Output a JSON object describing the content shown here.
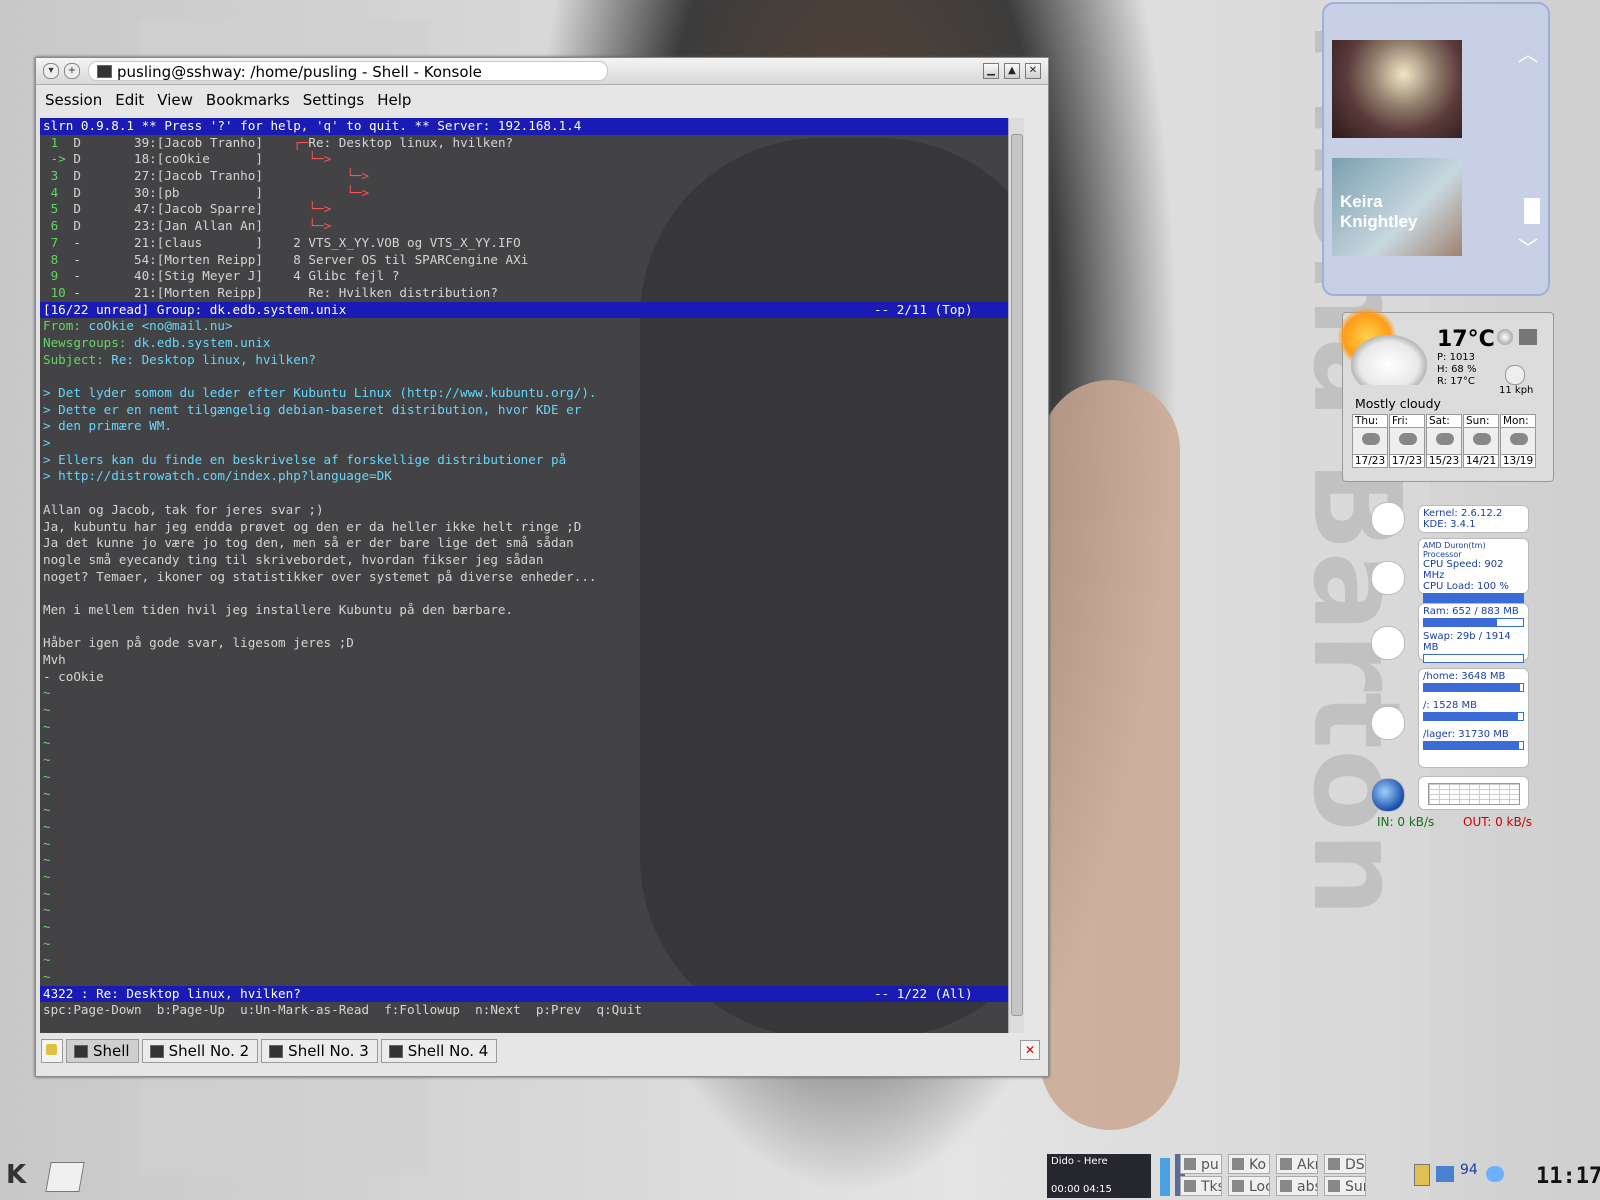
{
  "window": {
    "title": "pusling@sshway: /home/pusling - Shell - Konsole",
    "menu": [
      "Session",
      "Edit",
      "View",
      "Bookmarks",
      "Settings",
      "Help"
    ]
  },
  "terminal": {
    "header": "slrn 0.9.8.1 ** Press '?' for help, 'q' to quit. ** Server: 192.168.1.4",
    "threads": [
      {
        "num": "1",
        "flag": "D",
        "score": "39",
        "author": "[Jacob Tranho]",
        "tree": "┌─",
        "subject": "Re: Desktop linux, hvilken?"
      },
      {
        "num": "->",
        "flag": "D",
        "score": "18",
        "author": "[coOkie      ]",
        "tree": "  └─>",
        "subject": ""
      },
      {
        "num": "3",
        "flag": "D",
        "score": "27",
        "author": "[Jacob Tranho]",
        "tree": "       └─>",
        "subject": ""
      },
      {
        "num": "4",
        "flag": "D",
        "score": "30",
        "author": "[pb          ]",
        "tree": "       └─>",
        "subject": ""
      },
      {
        "num": "5",
        "flag": "D",
        "score": "47",
        "author": "[Jacob Sparre]",
        "tree": "  └─>",
        "subject": ""
      },
      {
        "num": "6",
        "flag": "D",
        "score": "23",
        "author": "[Jan Allan An]",
        "tree": "  └─>",
        "subject": ""
      },
      {
        "num": "7",
        "flag": "-",
        "score": "21",
        "author": "[claus       ]",
        "tree": "2 ",
        "subject": "VTS_X_YY.VOB og VTS_X_YY.IFO"
      },
      {
        "num": "8",
        "flag": "-",
        "score": "54",
        "author": "[Morten Reipp]",
        "tree": "8 ",
        "subject": "Server OS til SPARCengine AXi"
      },
      {
        "num": "9",
        "flag": "-",
        "score": "40",
        "author": "[Stig Meyer J]",
        "tree": "4 ",
        "subject": "Glibc fejl ?"
      },
      {
        "num": "10",
        "flag": "-",
        "score": "21",
        "author": "[Morten Reipp]",
        "tree": "  ",
        "subject": "Re: Hvilken distribution?"
      }
    ],
    "group_status_left": "[16/22 unread] Group: dk.edb.system.unix",
    "group_status_right": "-- 2/11 (Top)",
    "headers": {
      "from_label": "From:",
      "from": "coOkie <no@mail.nu>",
      "newsgroups_label": "Newsgroups:",
      "newsgroups": "dk.edb.system.unix",
      "subject_label": "Subject:",
      "subject": "Re: Desktop linux, hvilken?"
    },
    "quoted": [
      "> Det lyder somom du leder efter Kubuntu Linux (http://www.kubuntu.org/).",
      "> Dette er en nemt tilgængelig debian-baseret distribution, hvor KDE er",
      "> den primære WM.",
      ">",
      "> Ellers kan du finde en beskrivelse af forskellige distributioner på",
      "> http://distrowatch.com/index.php?language=DK"
    ],
    "body": [
      "",
      "Allan og Jacob, tak for jeres svar ;)",
      "Ja, kubuntu har jeg endda prøvet og den er da heller ikke helt ringe ;D",
      "Ja det kunne jo være jo tog den, men så er der bare lige det små sådan",
      "nogle små eyecandy ting til skrivebordet, hvordan fikser jeg sådan",
      "noget? Temaer, ikoner og statistikker over systemet på diverse enheder...",
      "",
      "Men i mellem tiden hvil jeg installere Kubuntu på den bærbare.",
      "",
      "Håber igen på gode svar, ligesom jeres ;D",
      "Mvh",
      "- coOkie"
    ],
    "tilde_count": 18,
    "article_status_left": "4322 : Re: Desktop linux, hvilken?",
    "article_status_right": "-- 1/22 (All)",
    "help_line": "spc:Page-Down  b:Page-Up  u:Un-Mark-as-Read  f:Followup  n:Next  p:Prev  q:Quit"
  },
  "tabs": [
    "Shell",
    "Shell No. 2",
    "Shell No. 3",
    "Shell No. 4"
  ],
  "image_widget": {
    "thumb2_caption": "Keira Knightley"
  },
  "weather": {
    "temp": "17°C",
    "pressure": "P: 1013",
    "humidity": "H: 68 %",
    "realfeel": "R: 17°C",
    "wind": "11 kph",
    "description": "Mostly cloudy",
    "forecast": [
      {
        "day": "Thu:",
        "temps": "17/23"
      },
      {
        "day": "Fri:",
        "temps": "17/23"
      },
      {
        "day": "Sat:",
        "temps": "15/23"
      },
      {
        "day": "Sun:",
        "temps": "14/21"
      },
      {
        "day": "Mon:",
        "temps": "13/19"
      }
    ]
  },
  "sysmon": {
    "kernel": "Kernel:  2.6.12.2",
    "kde": "KDE: 3.4.1",
    "cpu_name": "AMD Duron(tm) Processor",
    "cpu_speed": "CPU Speed:   902 MHz",
    "cpu_load": "CPU Load:   100 %",
    "cpu_load_frac": 1.0,
    "ram": "Ram: 652 / 883 MB",
    "ram_frac": 0.74,
    "swap": "Swap: 29b / 1914 MB",
    "swap_frac": 0.0,
    "home": "/home: 3648 MB",
    "home_frac": 0.97,
    "root": "/: 1528 MB",
    "root_frac": 0.95,
    "lager": "/lager: 31730 MB",
    "lager_frac": 0.96,
    "net_in": "IN: 0 kB/s",
    "net_out": "OUT: 0 kB/s"
  },
  "taskbar": {
    "player_title": "Dido - Here",
    "player_time": "00:00   04:15",
    "tasks": [
      "pu",
      "Ko",
      "Akr",
      "DSI",
      "Tks",
      "Loc",
      "abs",
      "Sur"
    ],
    "tray_number": "94",
    "clock": "11:17"
  },
  "wallpaper_text": "Misha Barton"
}
